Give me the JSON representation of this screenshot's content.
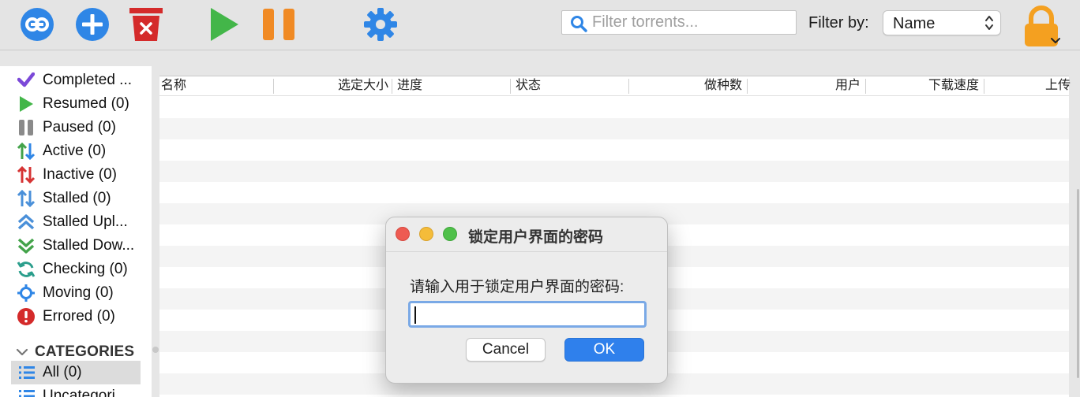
{
  "toolbar": {
    "filter_placeholder": "Filter torrents...",
    "filter_by_label": "Filter by:",
    "filter_by_value": "Name"
  },
  "status_filters": [
    {
      "label": "Completed ...",
      "icon": "check-icon"
    },
    {
      "label": "Resumed (0)",
      "icon": "play-icon"
    },
    {
      "label": "Paused (0)",
      "icon": "pause-icon"
    },
    {
      "label": "Active (0)",
      "icon": "active-arrows-icon"
    },
    {
      "label": "Inactive (0)",
      "icon": "inactive-arrows-icon"
    },
    {
      "label": "Stalled (0)",
      "icon": "stalled-arrows-icon"
    },
    {
      "label": "Stalled Upl...",
      "icon": "stalled-upload-icon"
    },
    {
      "label": "Stalled Dow...",
      "icon": "stalled-download-icon"
    },
    {
      "label": "Checking (0)",
      "icon": "refresh-icon"
    },
    {
      "label": "Moving (0)",
      "icon": "moving-icon"
    },
    {
      "label": "Errored (0)",
      "icon": "error-icon"
    }
  ],
  "categories": {
    "header": "CATEGORIES",
    "items": [
      {
        "label": "All (0)",
        "selected": true
      },
      {
        "label": "Uncategori..."
      }
    ]
  },
  "table": {
    "columns": [
      "名称",
      "选定大小",
      "进度",
      "状态",
      "做种数",
      "用户",
      "下载速度",
      "上传"
    ]
  },
  "dialog": {
    "title": "锁定用户界面的密码",
    "prompt": "请输入用于锁定用户界面的密码:",
    "input_value": "",
    "cancel_label": "Cancel",
    "ok_label": "OK"
  },
  "colors": {
    "toolbar_blue": "#2f86e6",
    "delete_red": "#d42a2a",
    "resume_green": "#43b649",
    "pause_orange": "#f08a24",
    "lock_orange": "#f4a020",
    "ok_blue": "#2f80ec"
  }
}
